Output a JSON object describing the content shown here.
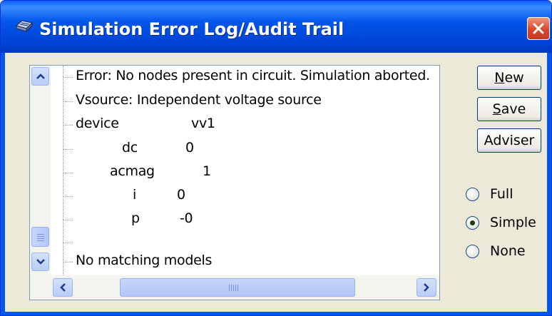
{
  "window": {
    "title": "Simulation Error Log/Audit Trail",
    "icon": "simulation-app-icon",
    "close_icon": "close-icon"
  },
  "log": {
    "rows": [
      {
        "name": "",
        "value": "Error: No nodes present in circuit. Simulation aborted."
      },
      {
        "name": "",
        "value": "Vsource: Independent voltage source"
      },
      {
        "name": "device",
        "value": "vv1"
      },
      {
        "name": "dc",
        "value": "0"
      },
      {
        "name": "acmag",
        "value": "1"
      },
      {
        "name": "i",
        "value": "0"
      },
      {
        "name": "p",
        "value": "-0"
      },
      {
        "name": "",
        "value": ""
      },
      {
        "name": "",
        "value": "No matching models"
      }
    ]
  },
  "buttons": {
    "new_prefix": "",
    "new_mnemonic": "N",
    "new_rest": "ew",
    "save_prefix": "",
    "save_mnemonic": "S",
    "save_rest": "ave",
    "adviser": "Adviser"
  },
  "mode": {
    "options": [
      "Full",
      "Simple",
      "None"
    ],
    "selected": "Simple"
  },
  "colors": {
    "title_bar": "#0256ea",
    "close_button": "#d8462c",
    "dialog_face": "#ece9d8"
  }
}
